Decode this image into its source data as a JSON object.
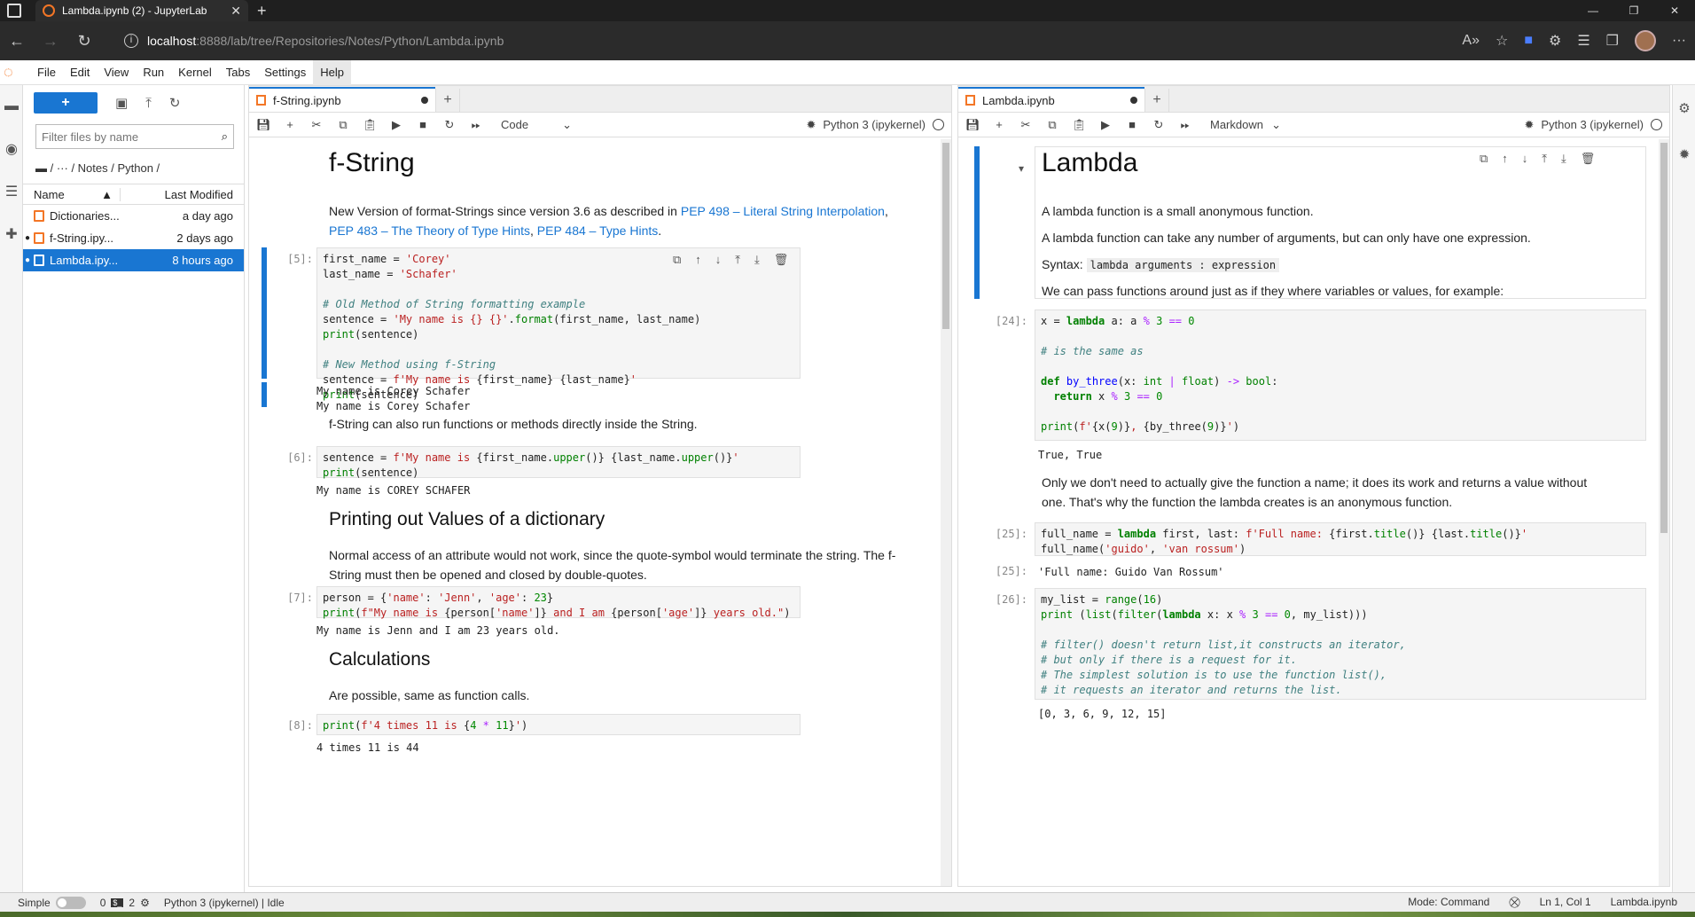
{
  "browser": {
    "tab_title": "Lambda.ipynb (2) - JupyterLab",
    "url_host": "localhost",
    "url_path": ":8888/lab/tree/Repositories/Notes/Python/Lambda.ipynb"
  },
  "menu": [
    "File",
    "Edit",
    "View",
    "Run",
    "Kernel",
    "Tabs",
    "Settings",
    "Help"
  ],
  "filebrowser": {
    "new_label": "+",
    "filter_placeholder": "Filter files by name",
    "breadcrumb": "/  ···  / Notes / Python /",
    "col_name": "Name",
    "col_modified": "Last Modified",
    "files": [
      {
        "name": "Dictionaries...",
        "modified": "a day ago",
        "running": false
      },
      {
        "name": "f-String.ipy...",
        "modified": "2 days ago",
        "running": true
      },
      {
        "name": "Lambda.ipy...",
        "modified": "8 hours ago",
        "running": true
      }
    ]
  },
  "left_nb": {
    "tab": "f-String.ipynb",
    "celltype": "Code",
    "kernel": "Python 3 (ipykernel)",
    "h1": "f-String",
    "intro_pre": "New Version of format-Strings since version 3.6 as described in ",
    "link1": "PEP 498 – Literal String Interpolation",
    "sep1": ", ",
    "link2": "PEP 483 – The Theory of Type Hints",
    "sep2": ", ",
    "link3": "PEP 484 – Type Hints",
    "intro_post": ".",
    "p5": "[5]:",
    "out5a": "My name is Corey Schafer",
    "out5b": "My name is Corey Schafer",
    "md2": "f-String can also run functions or methods directly inside the String.",
    "p6": "[6]:",
    "out6": "My name is COREY SCHAFER",
    "h2a": "Printing out Values of a dictionary",
    "md3": "Normal access of an attribute would not work, since the quote-symbol would terminate the string. The f-String must then be opened and closed by double-quotes.",
    "p7": "[7]:",
    "out7": "My name is Jenn and I am 23 years old.",
    "h2b": "Calculations",
    "md4": "Are possible, same as function calls.",
    "p8": "[8]:",
    "out8": "4 times 11 is 44"
  },
  "right_nb": {
    "tab": "Lambda.ipynb",
    "celltype": "Markdown",
    "kernel": "Python 3 (ipykernel)",
    "h1": "Lambda",
    "p1": "A lambda function is a small anonymous function.",
    "p2": "A lambda function can take any number of arguments, but can only have one expression.",
    "syntax_label": "Syntax:",
    "syntax_code": "lambda arguments : expression",
    "p3": "We can pass functions around just as if they where variables or values, for example:",
    "p24": "[24]:",
    "out24": "True, True",
    "md5": "Only we don't need to actually give the function a name; it does its work and returns a value without one. That's why the function the lambda creates is an anonymous function.",
    "p25": "[25]:",
    "p25o": "[25]:",
    "out25": "'Full name: Guido Van Rossum'",
    "p26": "[26]:",
    "out26": "[0, 3, 6, 9, 12, 15]"
  },
  "status": {
    "mode_label": "Simple",
    "terminals": "0",
    "kernels": "2",
    "kernel_state": "Python 3 (ipykernel) | Idle",
    "mode": "Mode: Command",
    "position": "Ln 1, Col 1",
    "file": "Lambda.ipynb"
  },
  "colors": {
    "accent": "#1976d2",
    "jupyter_orange": "#f37626"
  }
}
